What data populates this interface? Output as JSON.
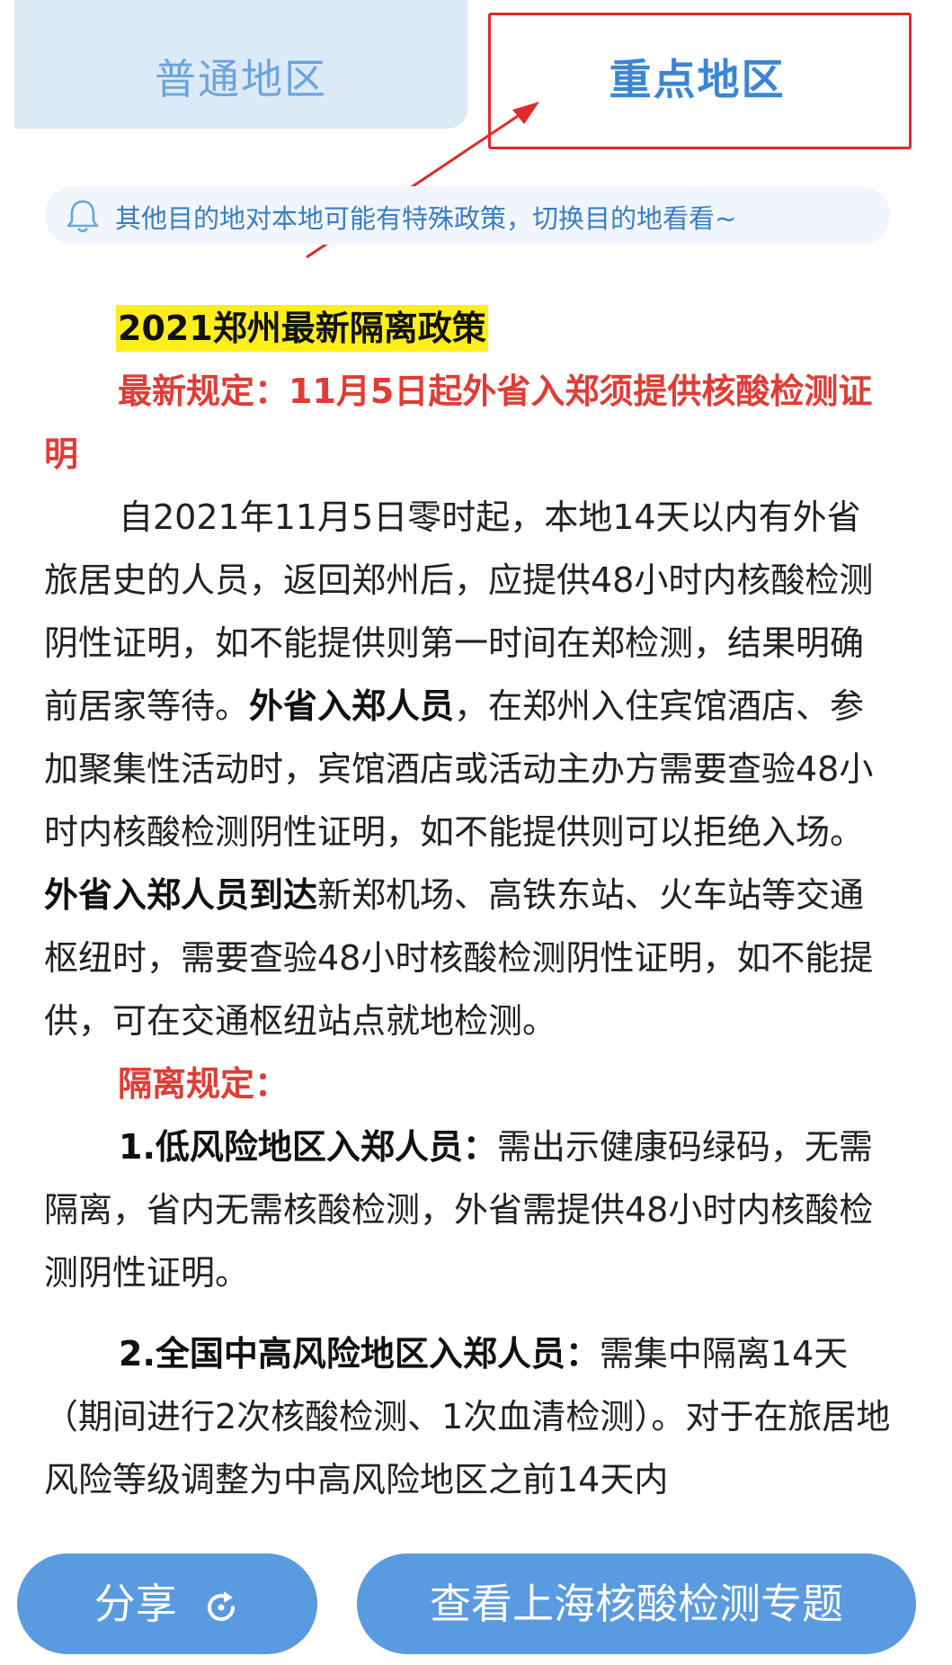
{
  "tabs": {
    "normal": "普通地区",
    "key": "重点地区"
  },
  "notice": {
    "icon": "bell-icon",
    "text": "其他目的地对本地可能有特殊政策，切换目的地看看~"
  },
  "article": {
    "title": "2021郑州最新隔离政策",
    "latest_rule_heading": "最新规定：11月5日起外省入郑须提供核酸检测证明",
    "para1": {
      "t1": "自2021年11月5日零时起，本地14天以内有外省旅居史的人员，返回郑州后，应提供48小时内核酸检测阴性证明，如不能提供则第一时间在郑检测，结果明确前居家等待。",
      "b1": "外省入郑人员",
      "t2": "，在郑州入住宾馆酒店、参加聚集性活动时，宾馆酒店或活动主办方需要查验48小时内核酸检测阴性证明，如不能提供则可以拒绝入场。",
      "b2": "外省入郑人员到达",
      "t3": "新郑机场、高铁东站、火车站等交通枢纽时，需要查验48小时核酸检测阴性证明，如不能提供，可在交通枢纽站点就地检测。"
    },
    "quarantine_heading": "隔离规定：",
    "item1": {
      "label": "1.低风险地区入郑人员：",
      "text": "需出示健康码绿码，无需隔离，省内无需核酸检测，外省需提供48小时内核酸检测阴性证明。"
    },
    "item2": {
      "label": "2.全国中高风险地区入郑人员：",
      "text": "需集中隔离14天（期间进行2次核酸检测、1次血清检测）。对于在旅居地风险等级调整为中高风险地区之前14天内"
    }
  },
  "buttons": {
    "share": "分享",
    "share_icon": "refresh-share-icon",
    "topic": "查看上海核酸检测专题"
  },
  "colors": {
    "annotation_red": "#e02a2a",
    "tab_blue": "#3b86d4",
    "highlight_yellow": "#ffee1a",
    "heading_red": "#e03c35",
    "button_blue": "#5a9ae0"
  }
}
